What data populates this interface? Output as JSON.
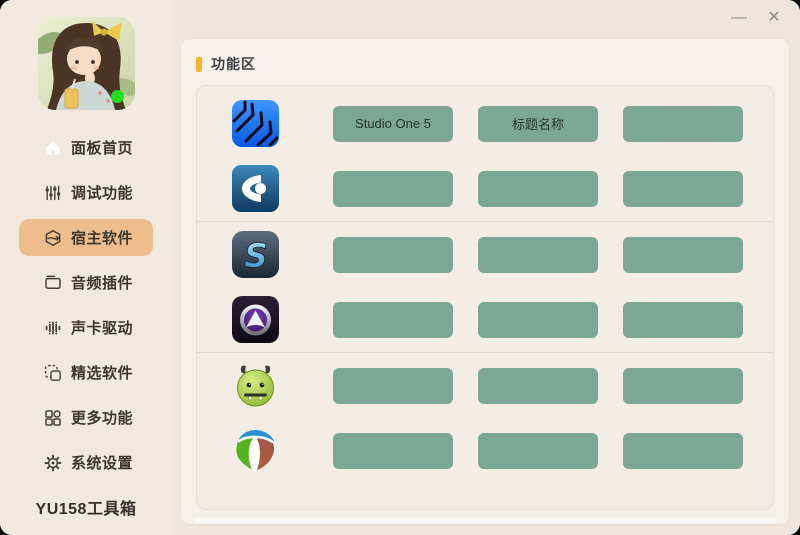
{
  "window": {
    "controls": {
      "minimize": "—",
      "close": "✕"
    }
  },
  "sidebar": {
    "footer_title": "YU158工具箱",
    "items": [
      {
        "label": "面板首页",
        "icon": "home-icon",
        "selected": false
      },
      {
        "label": "调试功能",
        "icon": "faders-icon",
        "selected": false
      },
      {
        "label": "宿主软件",
        "icon": "package-icon",
        "selected": true
      },
      {
        "label": "音频插件",
        "icon": "plugin-window-icon",
        "selected": false
      },
      {
        "label": "声卡驱动",
        "icon": "equalizer-icon",
        "selected": false
      },
      {
        "label": "精选软件",
        "icon": "selection-icon",
        "selected": false
      },
      {
        "label": "更多功能",
        "icon": "grid-icon",
        "selected": false
      },
      {
        "label": "系统设置",
        "icon": "gear-icon",
        "selected": false
      }
    ]
  },
  "main": {
    "section_title": "功能区",
    "groups": [
      {
        "rows": [
          {
            "app": "studio-one-icon",
            "buttons": [
              "Studio One 5",
              "标题名称",
              ""
            ]
          },
          {
            "app": "cubase-icon",
            "buttons": [
              "",
              "",
              ""
            ]
          }
        ]
      },
      {
        "rows": [
          {
            "app": "samplitude-icon",
            "buttons": [
              "",
              "",
              ""
            ]
          },
          {
            "app": "pro-tools-icon",
            "buttons": [
              "",
              "",
              ""
            ]
          }
        ]
      },
      {
        "rows": [
          {
            "app": "green-monster-icon",
            "buttons": [
              "",
              "",
              ""
            ]
          },
          {
            "app": "reaper-icon",
            "buttons": [
              "",
              "",
              ""
            ]
          }
        ]
      }
    ]
  },
  "colors": {
    "accent_yellow": "#f3b52a",
    "button_green": "#7da795",
    "selected_item_bg": "#eebd8d",
    "status_dot": "#1ddf1d",
    "sidebar_bg": "#f1e9dd",
    "card_bg": "#f5f0e9"
  }
}
